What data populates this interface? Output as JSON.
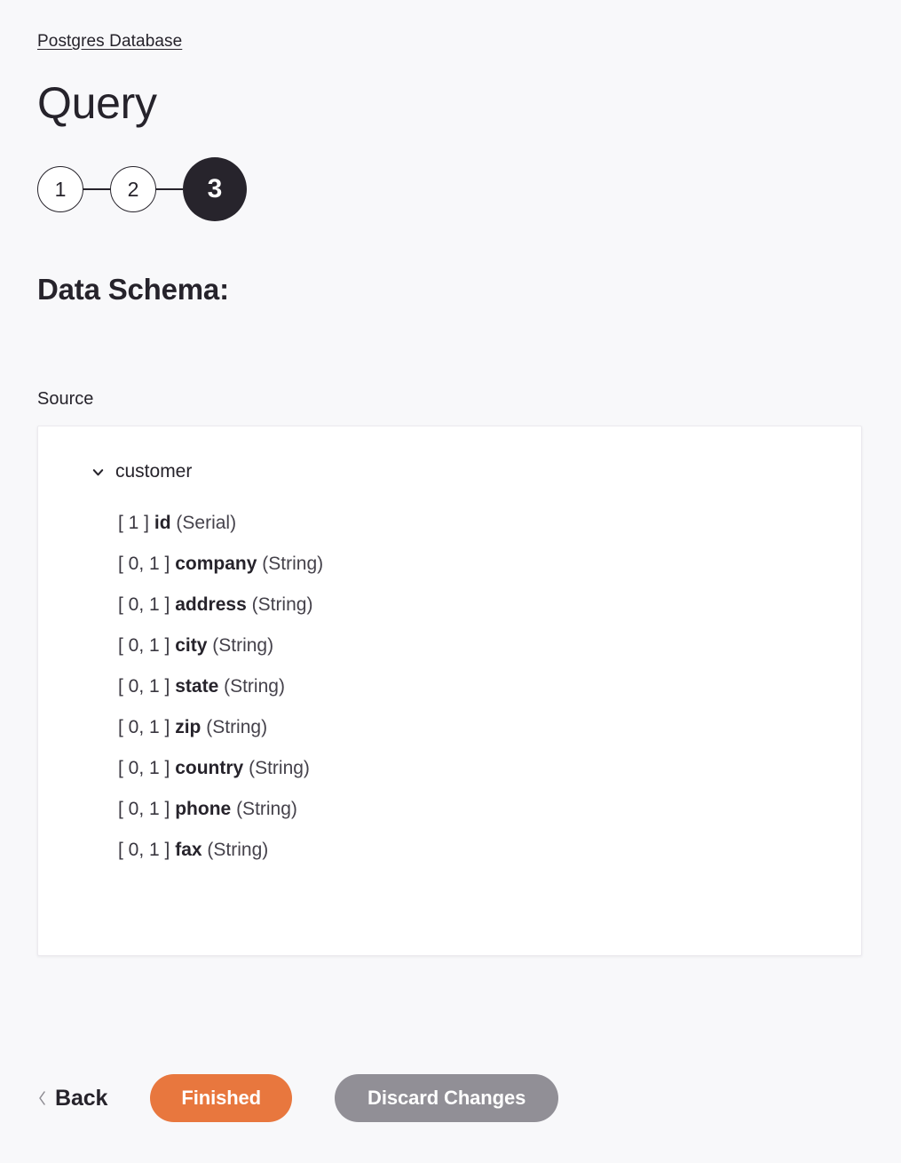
{
  "breadcrumb": {
    "label": "Postgres Database"
  },
  "header": {
    "title": "Query"
  },
  "stepper": {
    "steps": [
      {
        "label": "1",
        "state": "idle"
      },
      {
        "label": "2",
        "state": "idle"
      },
      {
        "label": "3",
        "state": "active"
      }
    ]
  },
  "schema_section": {
    "heading": "Data Schema:",
    "source_label": "Source",
    "tree": {
      "root": {
        "label": "customer",
        "expanded": true,
        "toggle_icon": "chevron-down-icon"
      },
      "fields": [
        {
          "cardinality": "[ 1 ]",
          "name": "id",
          "type": "(Serial)"
        },
        {
          "cardinality": "[ 0, 1 ]",
          "name": "company",
          "type": "(String)"
        },
        {
          "cardinality": "[ 0, 1 ]",
          "name": "address",
          "type": "(String)"
        },
        {
          "cardinality": "[ 0, 1 ]",
          "name": "city",
          "type": "(String)"
        },
        {
          "cardinality": "[ 0, 1 ]",
          "name": "state",
          "type": "(String)"
        },
        {
          "cardinality": "[ 0, 1 ]",
          "name": "zip",
          "type": "(String)"
        },
        {
          "cardinality": "[ 0, 1 ]",
          "name": "country",
          "type": "(String)"
        },
        {
          "cardinality": "[ 0, 1 ]",
          "name": "phone",
          "type": "(String)"
        },
        {
          "cardinality": "[ 0, 1 ]",
          "name": "fax",
          "type": "(String)"
        }
      ]
    }
  },
  "actions": {
    "back_label": "Back",
    "back_icon": "chevron-left-icon",
    "finished_label": "Finished",
    "discard_label": "Discard Changes"
  },
  "colors": {
    "page_background": "#f8f8fa",
    "panel_background": "#ffffff",
    "panel_border": "#eceaef",
    "text": "#26232b",
    "step_active_background": "#27242c",
    "primary_button": "#e8773e",
    "secondary_button": "#918f96"
  }
}
